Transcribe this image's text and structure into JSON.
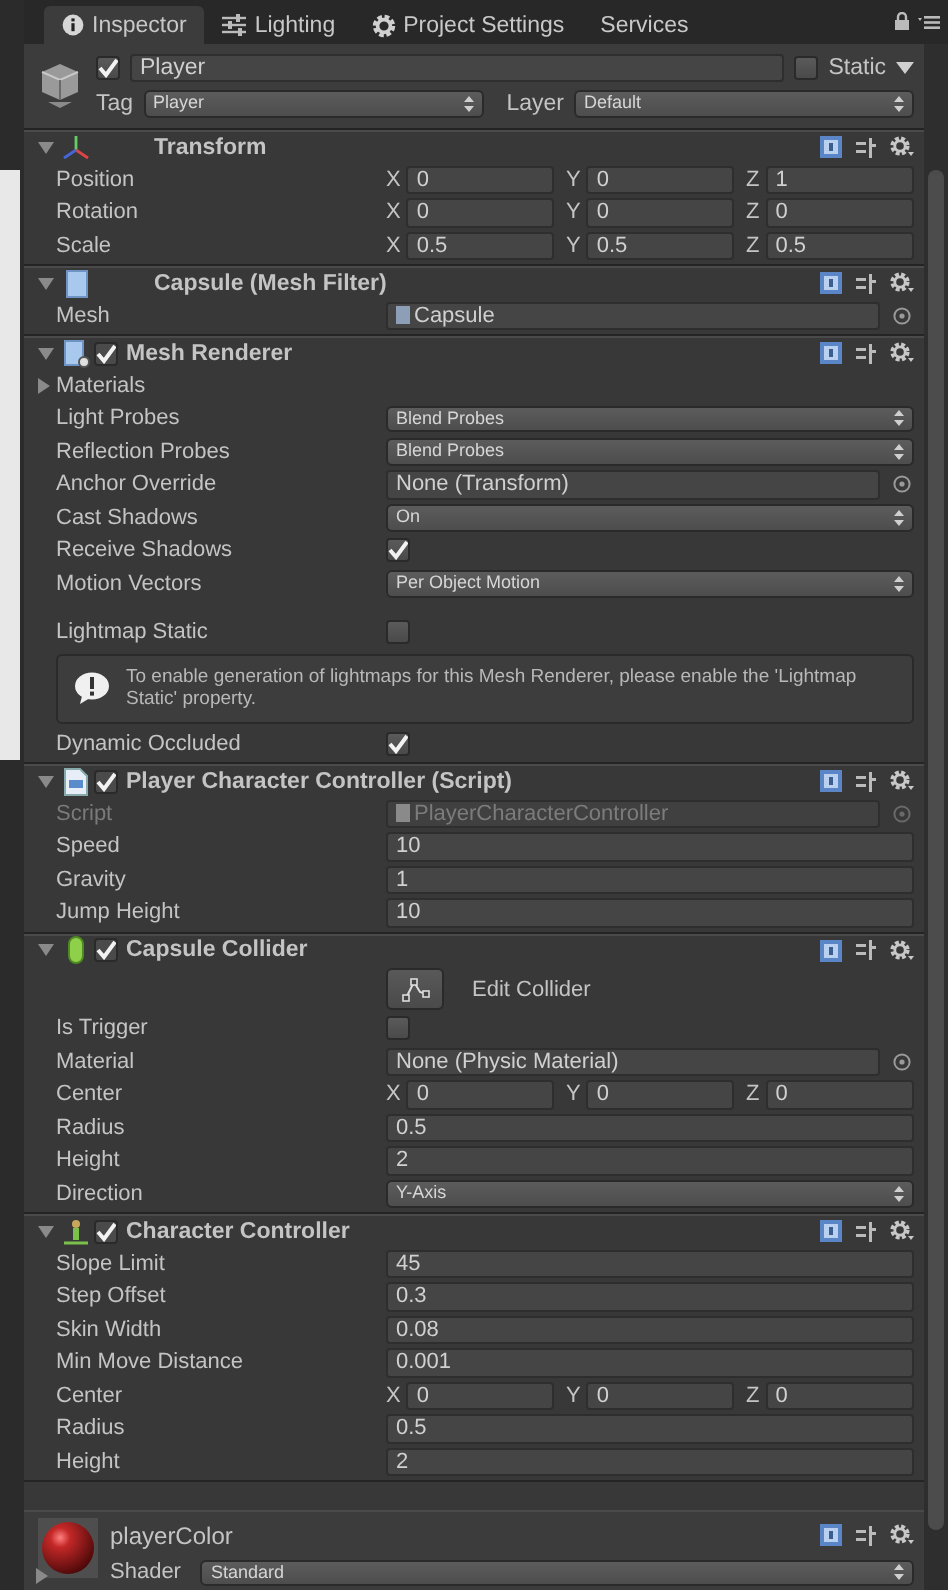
{
  "tabs": [
    {
      "label": "Inspector",
      "selected": true
    },
    {
      "label": "Lighting",
      "selected": false
    },
    {
      "label": "Project Settings",
      "selected": false
    },
    {
      "label": "Services",
      "selected": false
    }
  ],
  "object": {
    "active": true,
    "name": "Player",
    "static": false,
    "static_label": "Static",
    "tag_label": "Tag",
    "tag": "Player",
    "layer_label": "Layer",
    "layer": "Default"
  },
  "components": [
    {
      "title": "Transform",
      "expanded": true,
      "rows": [
        {
          "kind": "vector",
          "label": "Position",
          "axes": [
            {
              "axis": "X",
              "value": "0"
            },
            {
              "axis": "Y",
              "value": "0"
            },
            {
              "axis": "Z",
              "value": "1"
            }
          ]
        },
        {
          "kind": "vector",
          "label": "Rotation",
          "axes": [
            {
              "axis": "X",
              "value": "0"
            },
            {
              "axis": "Y",
              "value": "0"
            },
            {
              "axis": "Z",
              "value": "0"
            }
          ]
        },
        {
          "kind": "vector",
          "label": "Scale",
          "axes": [
            {
              "axis": "X",
              "value": "0.5"
            },
            {
              "axis": "Y",
              "value": "0.5"
            },
            {
              "axis": "Z",
              "value": "0.5"
            }
          ]
        }
      ]
    },
    {
      "title": "Capsule (Mesh Filter)",
      "expanded": true,
      "rows": [
        {
          "kind": "object",
          "label": "Mesh",
          "value": "Capsule",
          "disabled": false
        }
      ]
    },
    {
      "title": "Mesh Renderer",
      "enabled": true,
      "expanded": true,
      "rows": [
        {
          "kind": "foldout",
          "label": "Materials",
          "expanded": false
        },
        {
          "kind": "dropdown",
          "label": "Light Probes",
          "value": "Blend Probes"
        },
        {
          "kind": "dropdown",
          "label": "Reflection Probes",
          "value": "Blend Probes"
        },
        {
          "kind": "object",
          "label": "Anchor Override",
          "value": "None (Transform)",
          "disabled": false
        },
        {
          "kind": "dropdown",
          "label": "Cast Shadows",
          "value": "On"
        },
        {
          "kind": "checkbox",
          "label": "Receive Shadows",
          "checked": true
        },
        {
          "kind": "dropdown",
          "label": "Motion Vectors",
          "value": "Per Object Motion"
        },
        {
          "kind": "checkbox",
          "label": "Lightmap Static",
          "checked": false
        },
        {
          "kind": "help",
          "message": "To enable generation of lightmaps for this Mesh Renderer, please enable the 'Lightmap Static' property."
        },
        {
          "kind": "checkbox",
          "label": "Dynamic Occluded",
          "checked": true
        }
      ]
    },
    {
      "title": "Player Character Controller (Script)",
      "enabled": true,
      "expanded": true,
      "rows": [
        {
          "kind": "object",
          "label": "Script",
          "value": "PlayerCharacterController",
          "disabled": true
        },
        {
          "kind": "text",
          "label": "Speed",
          "value": "10"
        },
        {
          "kind": "text",
          "label": "Gravity",
          "value": "1"
        },
        {
          "kind": "text",
          "label": "Jump Height",
          "value": "10"
        }
      ]
    },
    {
      "title": "Capsule Collider",
      "enabled": true,
      "expanded": true,
      "rows": [
        {
          "kind": "button",
          "label": "Edit Collider"
        },
        {
          "kind": "checkbox",
          "label": "Is Trigger",
          "checked": false
        },
        {
          "kind": "object",
          "label": "Material",
          "value": "None (Physic Material)",
          "disabled": false
        },
        {
          "kind": "vector",
          "label": "Center",
          "axes": [
            {
              "axis": "X",
              "value": "0"
            },
            {
              "axis": "Y",
              "value": "0"
            },
            {
              "axis": "Z",
              "value": "0"
            }
          ]
        },
        {
          "kind": "text",
          "label": "Radius",
          "value": "0.5"
        },
        {
          "kind": "text",
          "label": "Height",
          "value": "2"
        },
        {
          "kind": "dropdown",
          "label": "Direction",
          "value": "Y-Axis"
        }
      ]
    },
    {
      "title": "Character Controller",
      "enabled": true,
      "expanded": true,
      "rows": [
        {
          "kind": "text",
          "label": "Slope Limit",
          "value": "45"
        },
        {
          "kind": "text",
          "label": "Step Offset",
          "value": "0.3"
        },
        {
          "kind": "text",
          "label": "Skin Width",
          "value": "0.08"
        },
        {
          "kind": "text",
          "label": "Min Move Distance",
          "value": "0.001"
        },
        {
          "kind": "vector",
          "label": "Center",
          "axes": [
            {
              "axis": "X",
              "value": "0"
            },
            {
              "axis": "Y",
              "value": "0"
            },
            {
              "axis": "Z",
              "value": "0"
            }
          ]
        },
        {
          "kind": "text",
          "label": "Radius",
          "value": "0.5"
        },
        {
          "kind": "text",
          "label": "Height",
          "value": "2"
        }
      ]
    }
  ],
  "material": {
    "name": "playerColor",
    "expanded": false,
    "shader_label": "Shader",
    "shader": "Standard"
  }
}
